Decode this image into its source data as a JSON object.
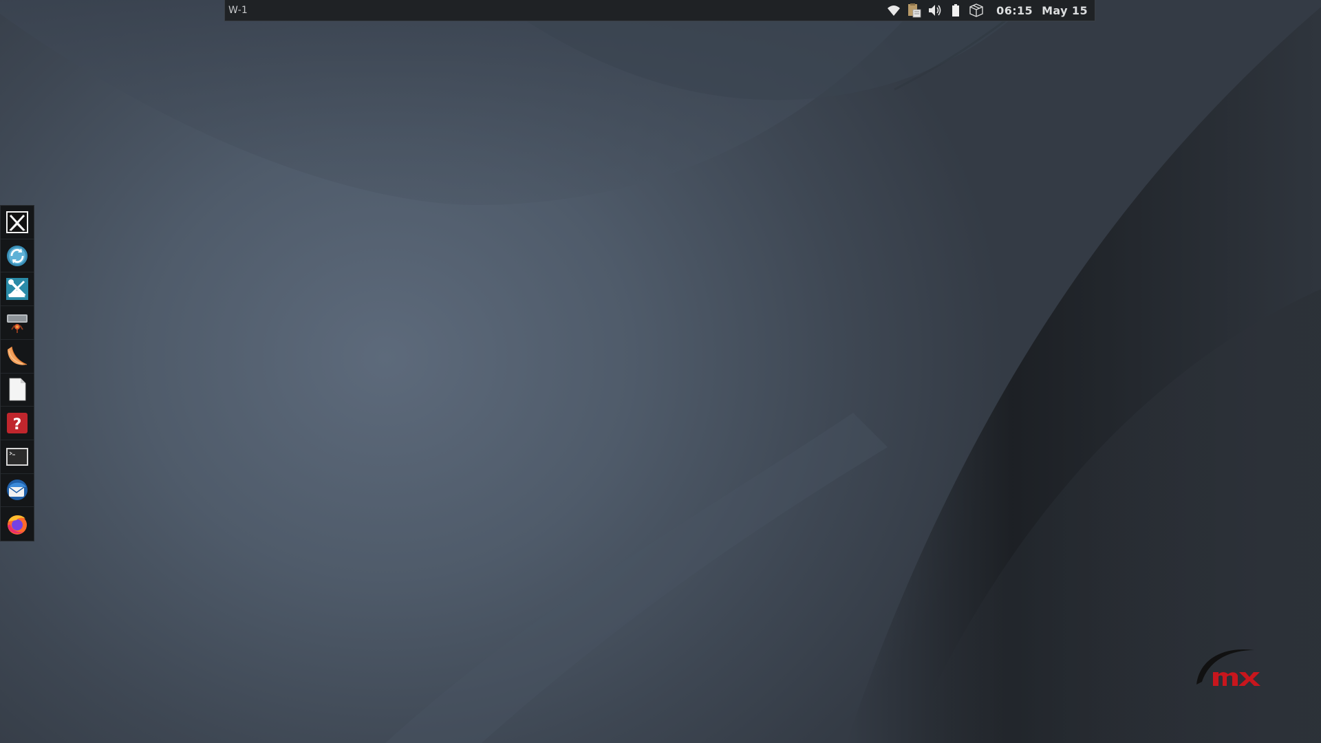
{
  "panel": {
    "workspace": "W-1",
    "tray": {
      "icons": [
        "wifi-icon",
        "clipboard-icon",
        "volume-icon",
        "battery-icon",
        "package-updates-icon"
      ]
    },
    "clock": "06:15",
    "date": "May 15"
  },
  "dock": {
    "items": [
      {
        "icon": "mx-tools-icon"
      },
      {
        "icon": "update-manager-icon"
      },
      {
        "icon": "settings-manager-icon"
      },
      {
        "icon": "file-manager-icon"
      },
      {
        "icon": "clementine-music-icon"
      },
      {
        "icon": "document-writer-icon"
      },
      {
        "icon": "help-icon"
      },
      {
        "icon": "terminal-icon"
      },
      {
        "icon": "thunderbird-mail-icon"
      },
      {
        "icon": "firefox-browser-icon"
      }
    ]
  },
  "colors": {
    "panel_bg": "#1f2225",
    "dock_bg": "#141618",
    "wallpaper_main": "#56626f",
    "logo_red": "#c8161d"
  }
}
